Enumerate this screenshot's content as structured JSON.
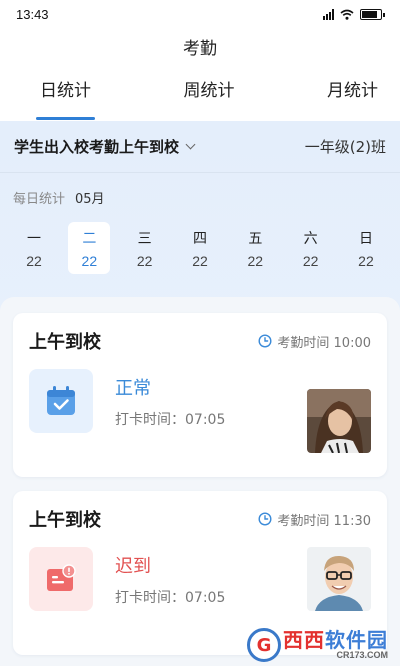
{
  "status_bar": {
    "time": "13:43"
  },
  "header": {
    "title": "考勤"
  },
  "tabs": [
    {
      "label": "日统计",
      "active": true
    },
    {
      "label": "周统计",
      "active": false
    },
    {
      "label": "月统计",
      "active": false
    }
  ],
  "filter": {
    "group_label": "学生出入校考勤上午到校",
    "class_label": "一年级(2)班"
  },
  "daily_stat": {
    "label": "每日统计",
    "month": "05月"
  },
  "week": [
    {
      "weekday": "一",
      "date": "22",
      "active": false
    },
    {
      "weekday": "二",
      "date": "22",
      "active": true
    },
    {
      "weekday": "三",
      "date": "22",
      "active": false
    },
    {
      "weekday": "四",
      "date": "22",
      "active": false
    },
    {
      "weekday": "五",
      "date": "22",
      "active": false
    },
    {
      "weekday": "六",
      "date": "22",
      "active": false
    },
    {
      "weekday": "日",
      "date": "22",
      "active": false
    }
  ],
  "records": [
    {
      "title": "上午到校",
      "attendance_time": "考勤时间 10:00",
      "status": "正常",
      "punch_time": "打卡时间：07:05",
      "status_color": "#3a8ad8",
      "icon": "calendar-check-icon"
    },
    {
      "title": "上午到校",
      "attendance_time": "考勤时间 11:30",
      "status": "迟到",
      "punch_time": "打卡时间：07:05",
      "status_color": "#e25252",
      "icon": "late-alert-icon"
    }
  ],
  "watermark": {
    "main_1": "西西",
    "main_2": "软件园",
    "sub": "CR173.COM"
  },
  "colors": {
    "accent": "#2f7fd6",
    "late": "#e25252",
    "section_bg": "#e4eefb"
  }
}
